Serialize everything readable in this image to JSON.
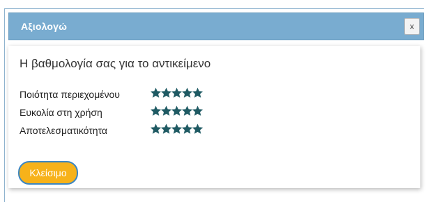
{
  "dialog": {
    "title": "Αξιολογώ",
    "close_label": "x"
  },
  "panel": {
    "heading": "Η βαθμολογία σας για το αντικείμενο",
    "ratings": [
      {
        "label": "Ποιότητα περιεχομένου",
        "stars": 5,
        "max": 5
      },
      {
        "label": "Ευκολία στη χρήση",
        "stars": 5,
        "max": 5
      },
      {
        "label": "Αποτελεσματικότητα",
        "stars": 5,
        "max": 5
      }
    ],
    "close_button_label": "Κλείσιμο"
  },
  "colors": {
    "titlebar": "#79acd0",
    "star": "#1f5a63",
    "button_fill": "#f7b21a",
    "button_border": "#3b86c3"
  }
}
